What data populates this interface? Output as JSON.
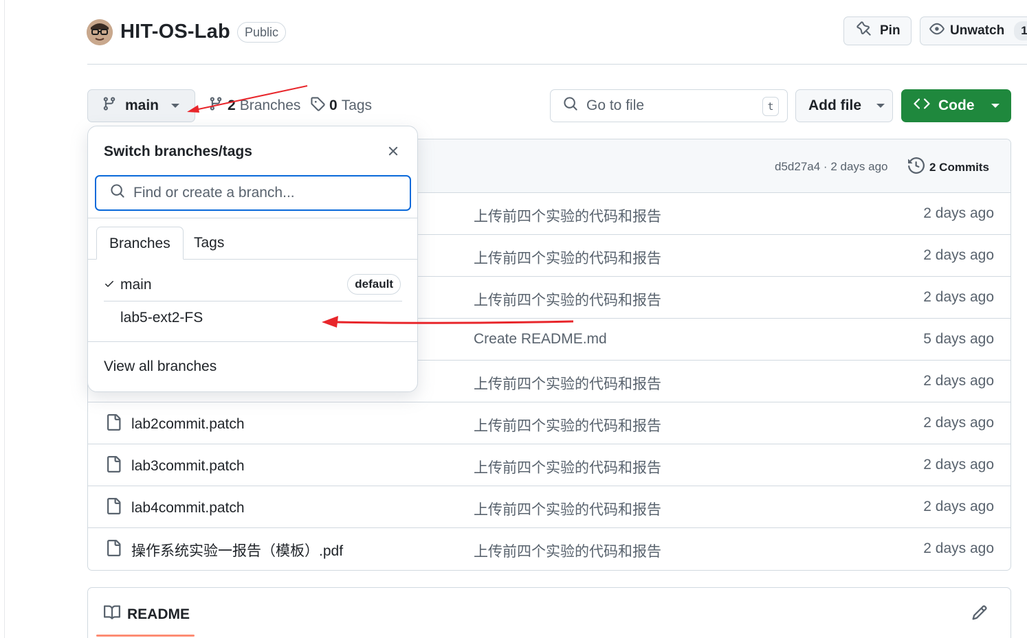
{
  "repo": {
    "name": "HIT-OS-Lab",
    "visibility": "Public"
  },
  "header": {
    "pin_label": "Pin",
    "unwatch_label": "Unwatch",
    "watch_count": "1"
  },
  "toolbar": {
    "branch": "main",
    "branches_count": "2",
    "branches_label": "Branches",
    "tags_count": "0",
    "tags_label": "Tags",
    "goto_placeholder": "Go to file",
    "goto_shortcut": "t",
    "add_file_label": "Add file",
    "code_label": "Code"
  },
  "latest_commit": {
    "hash": "d5d27a4",
    "separator": "·",
    "time": "2 days ago",
    "commits_label": "2 Commits"
  },
  "files": [
    {
      "name": "",
      "message": "上传前四个实验的代码和报告",
      "age": "2 days ago"
    },
    {
      "name": "",
      "message": "上传前四个实验的代码和报告",
      "age": "2 days ago"
    },
    {
      "name": "",
      "message": "上传前四个实验的代码和报告",
      "age": "2 days ago"
    },
    {
      "name": "",
      "message": "Create README.md",
      "age": "5 days ago"
    },
    {
      "name": "",
      "message": "上传前四个实验的代码和报告",
      "age": "2 days ago"
    },
    {
      "name": "lab2commit.patch",
      "message": "上传前四个实验的代码和报告",
      "age": "2 days ago"
    },
    {
      "name": "lab3commit.patch",
      "message": "上传前四个实验的代码和报告",
      "age": "2 days ago"
    },
    {
      "name": "lab4commit.patch",
      "message": "上传前四个实验的代码和报告",
      "age": "2 days ago"
    },
    {
      "name": "操作系统实验一报告（模板）.pdf",
      "message": "上传前四个实验的代码和报告",
      "age": "2 days ago"
    }
  ],
  "readme": {
    "label": "README"
  },
  "dropdown": {
    "title": "Switch branches/tags",
    "search_placeholder": "Find or create a branch...",
    "tab_branches": "Branches",
    "tab_tags": "Tags",
    "branches": [
      {
        "name": "main",
        "badge": "default",
        "selected": true
      },
      {
        "name": "lab5-ext2-FS",
        "badge": "",
        "selected": false
      }
    ],
    "footer_link": "View all branches"
  },
  "colors": {
    "accent": "#0969da",
    "code_button": "#1f883d",
    "annotation": "#e8262b",
    "readme_underline": "#fd8c73"
  }
}
